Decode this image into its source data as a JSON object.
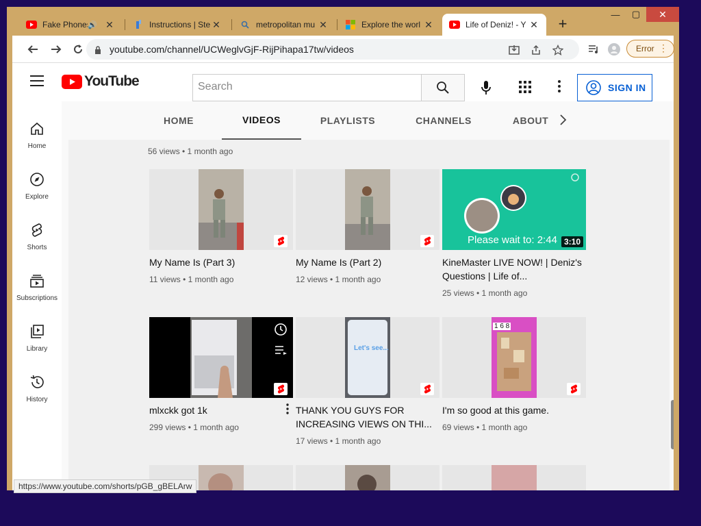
{
  "browser": {
    "tabs": [
      {
        "title": "Fake Phones",
        "icon": "youtube-icon",
        "audio": true
      },
      {
        "title": "Instructions | Ste",
        "icon": "steps-icon"
      },
      {
        "title": "metropolitan mu",
        "icon": "search-icon"
      },
      {
        "title": "Explore the worl",
        "icon": "microsoft-icon"
      },
      {
        "title": "Life of Deniz! - Y",
        "icon": "youtube-icon",
        "active": true
      }
    ],
    "new_tab": "+",
    "url": "youtube.com/channel/UCWeglvGjF-RijPihapa17tw/videos",
    "error_label": "Error",
    "status_url": "https://www.youtube.com/shorts/pGB_gBELArw"
  },
  "youtube": {
    "search_placeholder": "Search",
    "sign_in": "SIGN IN",
    "wordmark": "YouTube",
    "nav": [
      {
        "label": "Home",
        "icon": "home-icon"
      },
      {
        "label": "Explore",
        "icon": "compass-icon"
      },
      {
        "label": "Shorts",
        "icon": "shorts-icon"
      },
      {
        "label": "Subscriptions",
        "icon": "subscriptions-icon"
      },
      {
        "label": "Library",
        "icon": "library-icon"
      },
      {
        "label": "History",
        "icon": "history-icon"
      }
    ],
    "channel_tabs": [
      "HOME",
      "VIDEOS",
      "PLAYLISTS",
      "CHANNELS",
      "ABOUT"
    ],
    "active_tab": "VIDEOS",
    "prev_meta": "56 views • 1 month ago",
    "videos": [
      {
        "title": "My Name Is (Part 3)",
        "meta": "11 views • 1 month ago",
        "badge": "shorts"
      },
      {
        "title": "My Name Is (Part 2)",
        "meta": "12 views • 1 month ago",
        "badge": "shorts"
      },
      {
        "title": "KineMaster LIVE NOW! | Deniz's Questions | Life of...",
        "meta": "25 views • 1 month ago",
        "duration": "3:10",
        "overlay": "Please wait to: 2:44"
      },
      {
        "title": "mlxckk got 1k",
        "meta": "299 views • 1 month ago",
        "badge": "shorts"
      },
      {
        "title": "THANK YOU GUYS FOR INCREASING VIEWS ON THI...",
        "meta": "17 views • 1 month ago",
        "badge": "shorts",
        "overlay": "Let's see..."
      },
      {
        "title": "I'm so good at this game.",
        "meta": "69 views • 1 month ago",
        "badge": "shorts",
        "overlay": "1 6 8"
      }
    ]
  },
  "colors": {
    "youtube_red": "#ff0000",
    "link_blue": "#065fd4",
    "kinemaster_teal": "#18c39b"
  }
}
